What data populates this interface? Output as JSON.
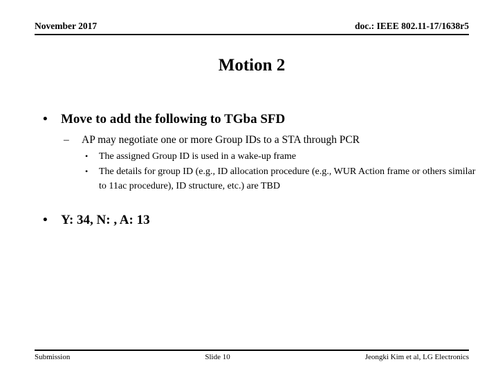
{
  "header": {
    "date": "November 2017",
    "doc_number": "doc.: IEEE 802.11-17/1638r5"
  },
  "title": "Motion 2",
  "content": {
    "bullet1": {
      "marker": "•",
      "text": "Move to add the following to TGba SFD"
    },
    "sub1": {
      "marker": "–",
      "text": "AP may negotiate one or more Group IDs to a STA through PCR"
    },
    "sub_sub1": {
      "marker": "•",
      "text": "The assigned Group ID is used in a wake-up frame"
    },
    "sub_sub2": {
      "marker": "•",
      "text": "The details for group ID (e.g., ID allocation procedure (e.g., WUR Action frame or others similar to 11ac procedure), ID structure, etc.) are TBD"
    },
    "bullet2": {
      "marker": "•",
      "text": "Y: 34, N: , A: 13"
    }
  },
  "footer": {
    "left": "Submission",
    "center": "Slide 10",
    "right": "Jeongki Kim et al, LG Electronics"
  }
}
